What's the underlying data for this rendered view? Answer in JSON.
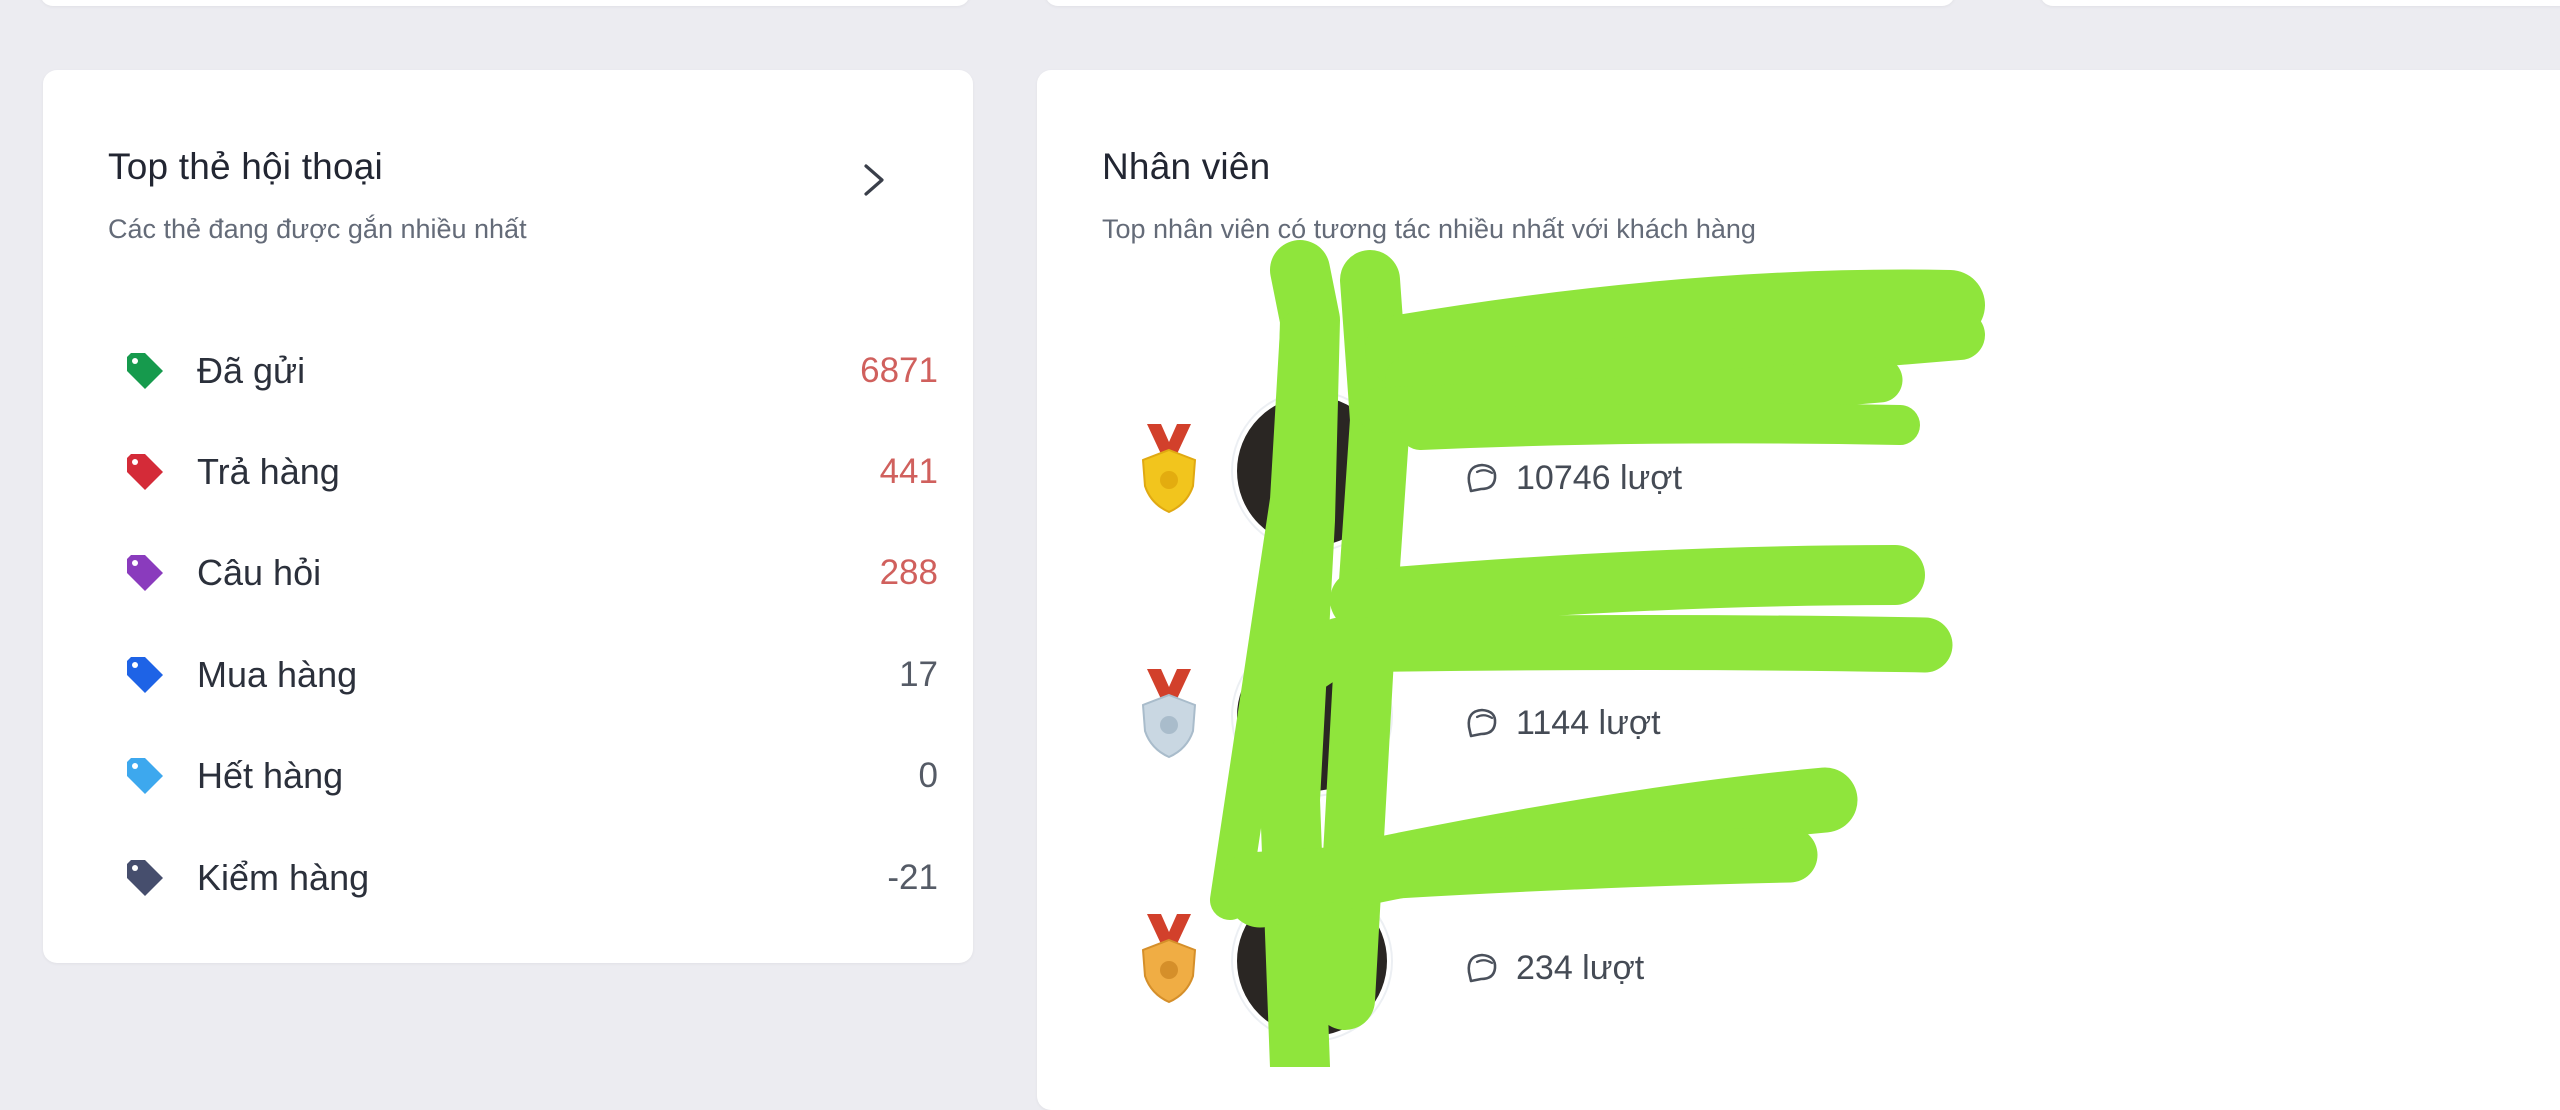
{
  "tags_panel": {
    "title": "Top thẻ hội thoại",
    "subtitle": "Các thẻ đang được gắn nhiều nhất",
    "items": [
      {
        "label": "Đã gửi",
        "count": "6871",
        "color": "#169a4d",
        "highlight": true
      },
      {
        "label": "Trả hàng",
        "count": "441",
        "color": "#d42b38",
        "highlight": true
      },
      {
        "label": "Câu hỏi",
        "count": "288",
        "color": "#8a3bbd",
        "highlight": true
      },
      {
        "label": "Mua hàng",
        "count": "17",
        "color": "#1e63e6",
        "highlight": false
      },
      {
        "label": "Hết hàng",
        "count": "0",
        "color": "#3da8ee",
        "highlight": false
      },
      {
        "label": "Kiểm hàng",
        "count": "-21",
        "color": "#464e6d",
        "highlight": false
      }
    ]
  },
  "staff_panel": {
    "title": "Nhân viên",
    "subtitle": "Top nhân viên có tương tác nhiều nhất với khách hàng",
    "items": [
      {
        "rank_medal": "gold-medal-icon",
        "interactions": "10746 lượt"
      },
      {
        "rank_medal": "silver-medal-icon",
        "interactions": "1144 lượt"
      },
      {
        "rank_medal": "bronze-medal-icon",
        "interactions": "234 lượt"
      }
    ]
  },
  "colors": {
    "background": "#ececf1",
    "card": "#ffffff",
    "highlight_count": "#d0605d",
    "redaction": "#8fe53c"
  }
}
